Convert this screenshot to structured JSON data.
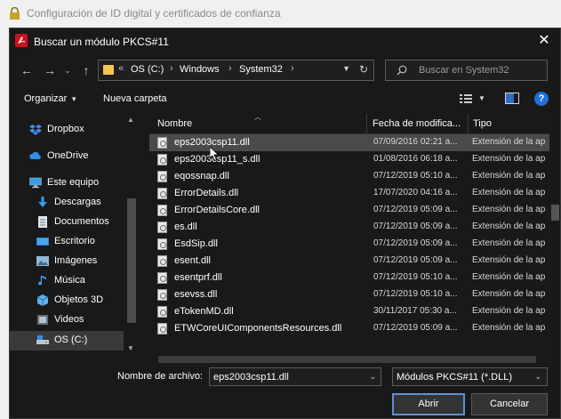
{
  "outer": {
    "title": "Configuración de ID digital y certificados de confianza"
  },
  "dialog": {
    "title": "Buscar un módulo PKCS#11",
    "close": "✕"
  },
  "nav": {
    "back": "←",
    "forward": "→",
    "up": "↑",
    "breadcrumb": [
      "OS (C:)",
      "Windows",
      "System32"
    ],
    "overflow": "«",
    "search_placeholder": "Buscar en System32"
  },
  "toolbar": {
    "organize_label": "Organizar",
    "new_folder_label": "Nueva carpeta",
    "help": "?"
  },
  "sidebar": {
    "items": [
      {
        "label": "Dropbox",
        "icon": "dropbox-icon"
      },
      {
        "label": "OneDrive",
        "icon": "cloud-icon"
      },
      {
        "label": "Este equipo",
        "icon": "computer-icon"
      },
      {
        "label": "Descargas",
        "icon": "download-icon"
      },
      {
        "label": "Documentos",
        "icon": "document-icon"
      },
      {
        "label": "Escritorio",
        "icon": "desktop-icon"
      },
      {
        "label": "Imágenes",
        "icon": "pictures-icon"
      },
      {
        "label": "Música",
        "icon": "music-icon"
      },
      {
        "label": "Objetos 3D",
        "icon": "cube-icon"
      },
      {
        "label": "Videos",
        "icon": "video-icon"
      },
      {
        "label": "OS (C:)",
        "icon": "drive-icon",
        "selected": true
      }
    ]
  },
  "columns": {
    "name": "Nombre",
    "date": "Fecha de modifica...",
    "type": "Tipo"
  },
  "files": [
    {
      "name": "eps2003csp11.dll",
      "date": "07/09/2016 02:21 a...",
      "type": "Extensión de la ap",
      "selected": true
    },
    {
      "name": "eps2003csp11_s.dll",
      "date": "01/08/2016 06:18 a...",
      "type": "Extensión de la ap"
    },
    {
      "name": "eqossnap.dll",
      "date": "07/12/2019 05:10 a...",
      "type": "Extensión de la ap"
    },
    {
      "name": "ErrorDetails.dll",
      "date": "17/07/2020 04:16 a...",
      "type": "Extensión de la ap"
    },
    {
      "name": "ErrorDetailsCore.dll",
      "date": "07/12/2019 05:09 a...",
      "type": "Extensión de la ap"
    },
    {
      "name": "es.dll",
      "date": "07/12/2019 05:09 a...",
      "type": "Extensión de la ap"
    },
    {
      "name": "EsdSip.dll",
      "date": "07/12/2019 05:09 a...",
      "type": "Extensión de la ap"
    },
    {
      "name": "esent.dll",
      "date": "07/12/2019 05:09 a...",
      "type": "Extensión de la ap"
    },
    {
      "name": "esentprf.dll",
      "date": "07/12/2019 05:10 a...",
      "type": "Extensión de la ap"
    },
    {
      "name": "esevss.dll",
      "date": "07/12/2019 05:10 a...",
      "type": "Extensión de la ap"
    },
    {
      "name": "eTokenMD.dll",
      "date": "30/11/2017 05:30 a...",
      "type": "Extensión de la ap"
    },
    {
      "name": "ETWCoreUIComponentsResources.dll",
      "date": "07/12/2019 05:09 a...",
      "type": "Extensión de la ap"
    }
  ],
  "bottom": {
    "filename_label": "Nombre de archivo:",
    "filename_value": "eps2003csp11.dll",
    "filter_value": "Módulos PKCS#11 (*.DLL)",
    "open_label": "Abrir",
    "cancel_label": "Cancelar"
  },
  "colors": {
    "dialog_bg": "#191919",
    "accent": "#1e6fd9",
    "pdf_red": "#c4161c"
  }
}
